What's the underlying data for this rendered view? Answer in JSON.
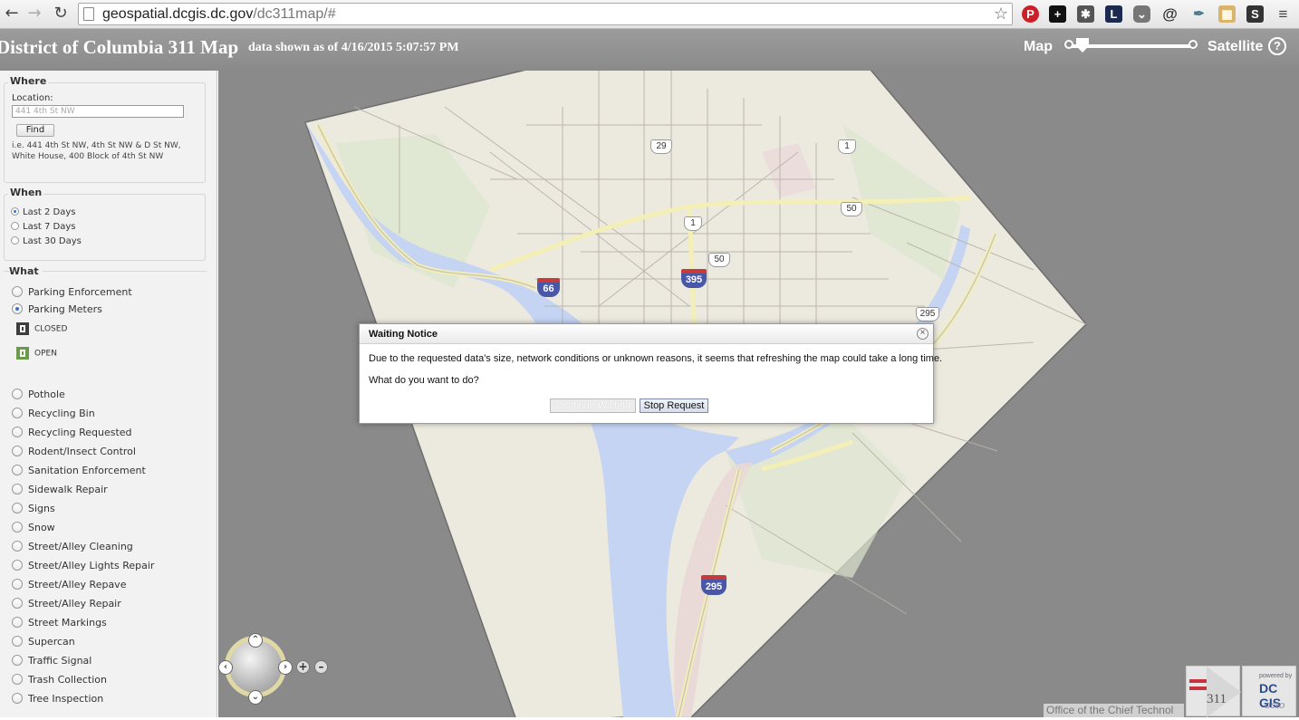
{
  "browser": {
    "url_host": "geospatial.dcgis.dc.gov",
    "url_path": "/dc311map/#"
  },
  "header": {
    "title": "District of Columbia 311 Map",
    "data_date": "data shown as of 4/16/2015 5:07:57 PM",
    "map_label": "Map",
    "satellite_label": "Satellite",
    "help_label": "?"
  },
  "where": {
    "legend": "Where",
    "location_label": "Location:",
    "location_placeholder": "441 4th St NW",
    "find_label": "Find",
    "hint": "i.e. 441 4th St NW, 4th St NW & D St NW, White House, 400 Block of 4th St NW"
  },
  "when": {
    "legend": "When",
    "options": [
      "Last 2 Days",
      "Last 7 Days",
      "Last 30 Days"
    ],
    "selected": "Last 2 Days"
  },
  "what": {
    "legend": "What",
    "top_items": [
      "Parking Enforcement",
      "Parking Meters"
    ],
    "selected": "Parking Meters",
    "status_legend": [
      "CLOSED",
      "OPEN"
    ],
    "items": [
      "Pothole",
      "Recycling Bin",
      "Recycling Requested",
      "Rodent/Insect Control",
      "Sanitation Enforcement",
      "Sidewalk Repair",
      "Signs",
      "Snow",
      "Street/Alley Cleaning",
      "Street/Alley Lights Repair",
      "Street/Alley Repave",
      "Street/Alley Repair",
      "Street Markings",
      "Supercan",
      "Traffic Signal",
      "Trash Collection",
      "Tree Inspection"
    ]
  },
  "map": {
    "highway_shields": [
      "29",
      "1",
      "1",
      "50",
      "50",
      "66",
      "395",
      "295",
      "295"
    ],
    "attribution": "Office of the Chief Technol",
    "logo_311": "311",
    "logo_powered": "powered by",
    "logo_dcgis": "DC GIS",
    "logo_octo": "octo"
  },
  "dialog": {
    "title": "Waiting Notice",
    "message": "Due to the requested data's size, network conditions or unknown reasons, it seems that refreshing the map could take a long time.",
    "question": "What do you want to do?",
    "continue_label": "Continue Waiting",
    "stop_label": "Stop Request"
  },
  "colors": {
    "header_bg": "#8f8f8f",
    "map_land": "#ece9df",
    "water": "#c4d4f2",
    "accent_blue": "#3a6fd0"
  }
}
